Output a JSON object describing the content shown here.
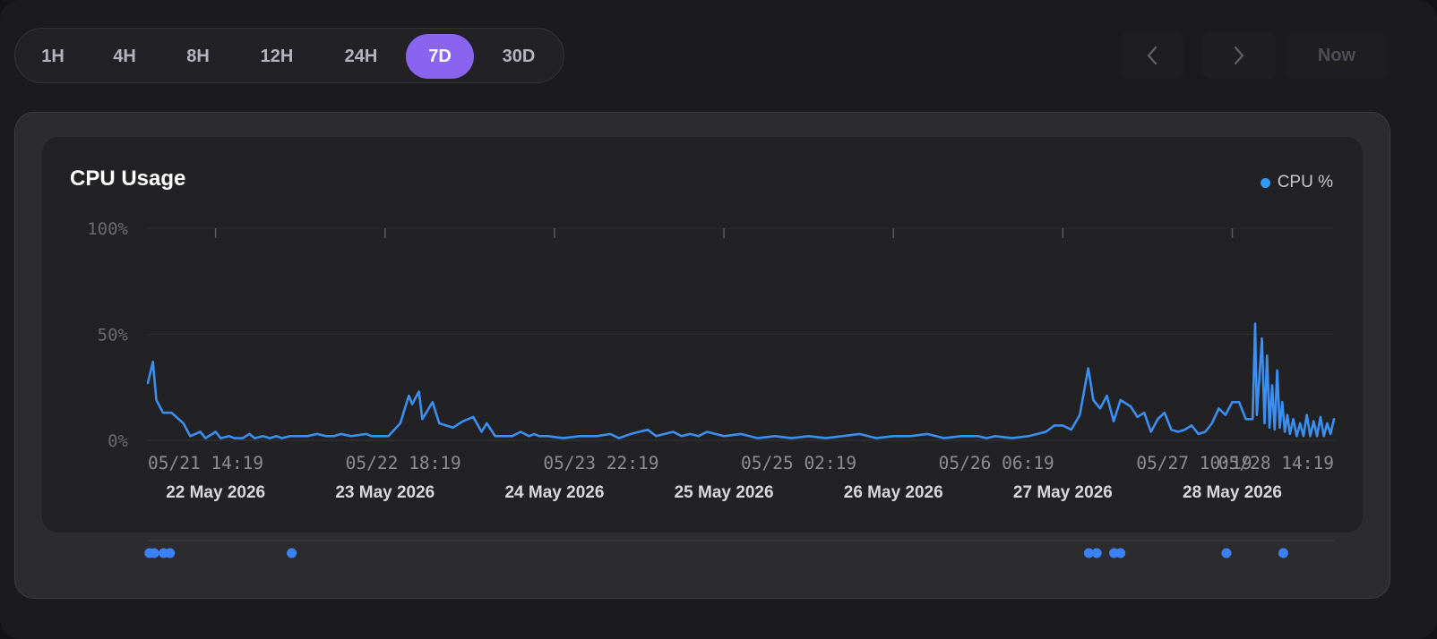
{
  "range_selector": {
    "options": [
      "1H",
      "4H",
      "8H",
      "12H",
      "24H",
      "7D",
      "30D"
    ],
    "selected": "7D"
  },
  "navigation": {
    "prev_icon": "chevron-left-icon",
    "next_icon": "chevron-right-icon",
    "now_label": "Now"
  },
  "chart_data": {
    "type": "line",
    "title": "CPU Usage",
    "legend": [
      "CPU %"
    ],
    "legend_position": "top-right",
    "series_color": "#3b8ff0",
    "grid": true,
    "ylim": [
      0,
      100
    ],
    "y_ticks": [
      "100%",
      "50%",
      "0%"
    ],
    "x_tick_labels": [
      "05/21 14:19",
      "05/22 18:19",
      "05/23 22:19",
      "05/25 02:19",
      "05/26 06:19",
      "05/27 10:19",
      "05/28 14:19"
    ],
    "day_labels": [
      "22 May 2026",
      "23 May 2026",
      "24 May 2026",
      "25 May 2026",
      "26 May 2026",
      "27 May 2026",
      "28 May 2026"
    ],
    "x_range_days": [
      0,
      7
    ],
    "series": [
      {
        "name": "CPU %",
        "points": [
          [
            0.0,
            27
          ],
          [
            0.03,
            37
          ],
          [
            0.05,
            19
          ],
          [
            0.09,
            13
          ],
          [
            0.14,
            13
          ],
          [
            0.21,
            8
          ],
          [
            0.25,
            2
          ],
          [
            0.31,
            4
          ],
          [
            0.34,
            1
          ],
          [
            0.4,
            4
          ],
          [
            0.43,
            1
          ],
          [
            0.48,
            2
          ],
          [
            0.51,
            1
          ],
          [
            0.56,
            1
          ],
          [
            0.6,
            3
          ],
          [
            0.63,
            1
          ],
          [
            0.68,
            2
          ],
          [
            0.72,
            1
          ],
          [
            0.76,
            2
          ],
          [
            0.79,
            1
          ],
          [
            0.84,
            2
          ],
          [
            0.89,
            2
          ],
          [
            0.94,
            2
          ],
          [
            1.0,
            3
          ],
          [
            1.05,
            2
          ],
          [
            1.1,
            2
          ],
          [
            1.14,
            3
          ],
          [
            1.2,
            2
          ],
          [
            1.29,
            3
          ],
          [
            1.32,
            2
          ],
          [
            1.36,
            2
          ],
          [
            1.42,
            2
          ],
          [
            1.49,
            8
          ],
          [
            1.54,
            21
          ],
          [
            1.56,
            17
          ],
          [
            1.6,
            23
          ],
          [
            1.62,
            10
          ],
          [
            1.68,
            18
          ],
          [
            1.72,
            8
          ],
          [
            1.8,
            6
          ],
          [
            1.86,
            9
          ],
          [
            1.92,
            11
          ],
          [
            1.97,
            4
          ],
          [
            2.0,
            8
          ],
          [
            2.05,
            2
          ],
          [
            2.15,
            2
          ],
          [
            2.2,
            4
          ],
          [
            2.25,
            2
          ],
          [
            2.28,
            3
          ],
          [
            2.31,
            2
          ],
          [
            2.36,
            2
          ],
          [
            2.45,
            1
          ],
          [
            2.55,
            2
          ],
          [
            2.65,
            2
          ],
          [
            2.73,
            3
          ],
          [
            2.78,
            1
          ],
          [
            2.85,
            3
          ],
          [
            2.95,
            5
          ],
          [
            3.0,
            2
          ],
          [
            3.05,
            3
          ],
          [
            3.1,
            4
          ],
          [
            3.15,
            2
          ],
          [
            3.2,
            3
          ],
          [
            3.25,
            2
          ],
          [
            3.3,
            4
          ],
          [
            3.4,
            2
          ],
          [
            3.5,
            3
          ],
          [
            3.6,
            1
          ],
          [
            3.7,
            2
          ],
          [
            3.8,
            1
          ],
          [
            3.9,
            2
          ],
          [
            4.0,
            1
          ],
          [
            4.1,
            2
          ],
          [
            4.2,
            3
          ],
          [
            4.3,
            1
          ],
          [
            4.4,
            2
          ],
          [
            4.5,
            2
          ],
          [
            4.6,
            3
          ],
          [
            4.7,
            1
          ],
          [
            4.8,
            2
          ],
          [
            4.9,
            2
          ],
          [
            4.95,
            1
          ],
          [
            5.0,
            2
          ],
          [
            5.1,
            1
          ],
          [
            5.2,
            2
          ],
          [
            5.3,
            4
          ],
          [
            5.35,
            7
          ],
          [
            5.4,
            7
          ],
          [
            5.45,
            5
          ],
          [
            5.5,
            12
          ],
          [
            5.55,
            34
          ],
          [
            5.58,
            19
          ],
          [
            5.62,
            15
          ],
          [
            5.66,
            21
          ],
          [
            5.7,
            9
          ],
          [
            5.74,
            19
          ],
          [
            5.8,
            16
          ],
          [
            5.84,
            11
          ],
          [
            5.88,
            13
          ],
          [
            5.92,
            4
          ],
          [
            5.96,
            10
          ],
          [
            6.0,
            13
          ],
          [
            6.04,
            5
          ],
          [
            6.08,
            4
          ],
          [
            6.12,
            5
          ],
          [
            6.16,
            7
          ],
          [
            6.2,
            3
          ],
          [
            6.24,
            4
          ],
          [
            6.28,
            8
          ],
          [
            6.32,
            15
          ],
          [
            6.36,
            12
          ],
          [
            6.4,
            18
          ],
          [
            6.44,
            18
          ],
          [
            6.48,
            10
          ],
          [
            6.52,
            10
          ],
          [
            6.535,
            55
          ],
          [
            6.545,
            12
          ],
          [
            6.56,
            30
          ],
          [
            6.575,
            48
          ],
          [
            6.59,
            8
          ],
          [
            6.605,
            40
          ],
          [
            6.62,
            6
          ],
          [
            6.635,
            26
          ],
          [
            6.65,
            5
          ],
          [
            6.665,
            33
          ],
          [
            6.68,
            6
          ],
          [
            6.695,
            18
          ],
          [
            6.71,
            4
          ],
          [
            6.725,
            12
          ],
          [
            6.74,
            3
          ],
          [
            6.76,
            10
          ],
          [
            6.78,
            2
          ],
          [
            6.8,
            8
          ],
          [
            6.82,
            2
          ],
          [
            6.84,
            12
          ],
          [
            6.86,
            2
          ],
          [
            6.88,
            9
          ],
          [
            6.9,
            2
          ],
          [
            6.92,
            11
          ],
          [
            6.94,
            2
          ],
          [
            6.96,
            8
          ],
          [
            6.98,
            3
          ],
          [
            7.0,
            10
          ]
        ]
      }
    ],
    "event_markers_days": [
      0.01,
      0.04,
      0.1,
      0.14,
      0.91,
      5.95,
      6.0,
      6.11,
      6.15,
      6.82,
      7.18
    ]
  }
}
